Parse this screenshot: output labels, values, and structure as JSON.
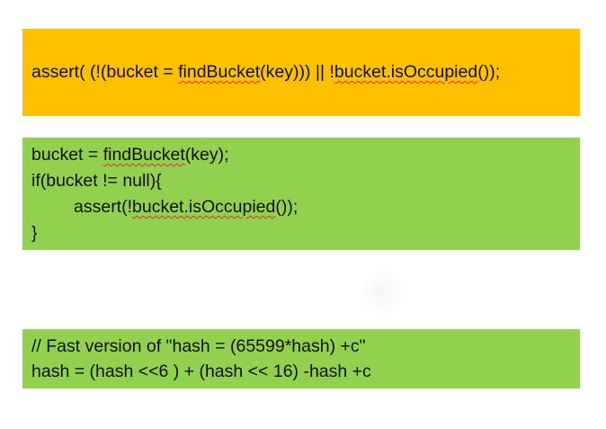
{
  "blocks": {
    "assert_one_line": {
      "p1": "assert( (!(bucket = ",
      "p2": "findBucket",
      "p3": "(key))) || !",
      "p4": "bucket.isOccupied",
      "p5": "());",
      "background": "#ffc000"
    },
    "if_version": {
      "line1_a": "bucket = ",
      "line1_b": "findBucket",
      "line1_c": "(key);",
      "line2": "if(bucket != null){",
      "line3_a": "assert(!",
      "line3_b": "bucket.isOccupied",
      "line3_c": "());",
      "line4": "}",
      "background": "#92d050"
    },
    "hash_snippet": {
      "line1": "// Fast version of \"hash = (65599*hash) +c\"",
      "line2": "hash = (hash <<6 ) + (hash << 16) -hash +c",
      "background": "#92d050"
    }
  }
}
